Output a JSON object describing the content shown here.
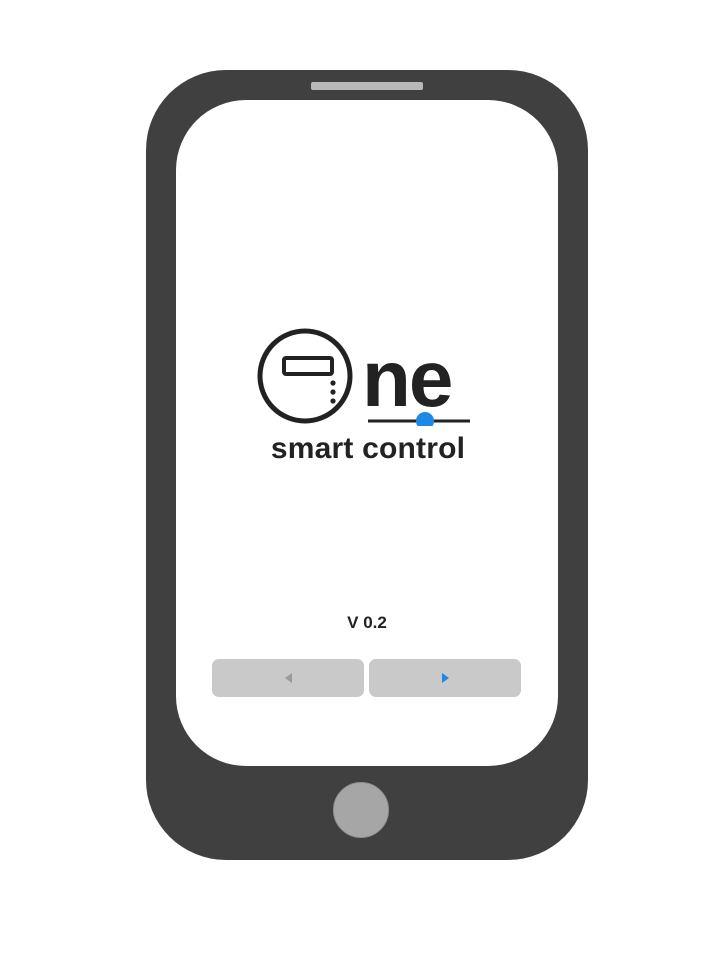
{
  "app": {
    "logo_text": "ne",
    "tagline": "smart control",
    "version": "V 0.2"
  },
  "navigation": {
    "prev_icon": "triangle-left-icon",
    "next_icon": "triangle-right-icon",
    "prev_enabled": false,
    "next_enabled": true
  },
  "colors": {
    "phone_body": "#404040",
    "screen": "#ffffff",
    "accent": "#1e88e5",
    "button_bg": "#c9c9c9"
  }
}
